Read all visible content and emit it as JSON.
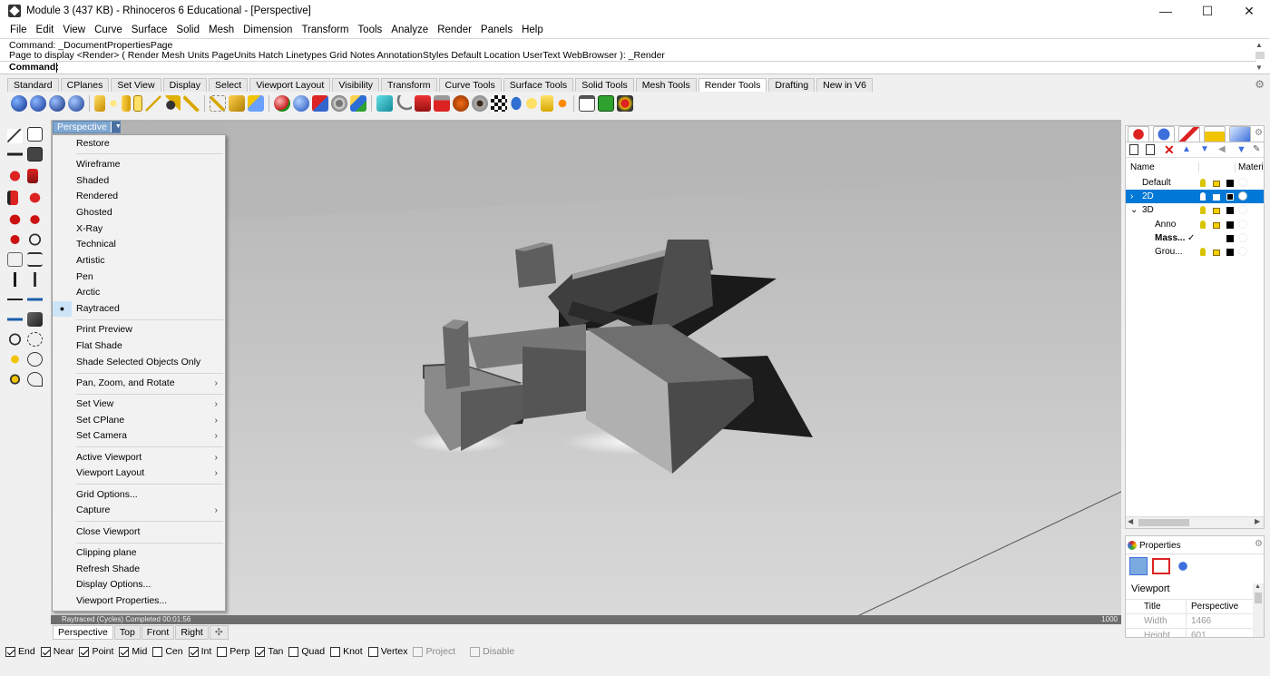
{
  "window": {
    "title": "Module 3 (437 KB) - Rhinoceros 6 Educational - [Perspective]",
    "controls": {
      "minimize": "—",
      "maximize": "☐",
      "close": "✕"
    }
  },
  "menu": [
    "File",
    "Edit",
    "View",
    "Curve",
    "Surface",
    "Solid",
    "Mesh",
    "Dimension",
    "Transform",
    "Tools",
    "Analyze",
    "Render",
    "Panels",
    "Help"
  ],
  "command": {
    "history": [
      "Command: _DocumentPropertiesPage",
      "Page to display <Render> ( Render  Mesh  Units  PageUnits  Hatch  Linetypes  Grid  Notes  AnnotationStyles  Default  Location  UserText  WebBrowser ): _Render"
    ],
    "prompt": "Command:"
  },
  "toolbar_tabs": [
    "Standard",
    "CPlanes",
    "Set View",
    "Display",
    "Select",
    "Viewport Layout",
    "Visibility",
    "Transform",
    "Curve Tools",
    "Surface Tools",
    "Solid Tools",
    "Mesh Tools",
    "Render Tools",
    "Drafting",
    "New in V6"
  ],
  "active_toolbar_tab": "Render Tools",
  "viewport": {
    "label": "Perspective",
    "status": "Raytraced (Cycles)   Completed   00:01:56",
    "resolution": "1000"
  },
  "viewport_tabs": [
    "Perspective",
    "Top",
    "Front",
    "Right"
  ],
  "context_menu": {
    "items": [
      {
        "label": "Restore"
      },
      {
        "label": "Wireframe"
      },
      {
        "label": "Shaded"
      },
      {
        "label": "Rendered"
      },
      {
        "label": "Ghosted"
      },
      {
        "label": "X-Ray"
      },
      {
        "label": "Technical"
      },
      {
        "label": "Artistic"
      },
      {
        "label": "Pen"
      },
      {
        "label": "Arctic"
      },
      {
        "label": "Raytraced",
        "checked": true
      },
      {
        "label": "Print Preview"
      },
      {
        "label": "Flat Shade"
      },
      {
        "label": "Shade Selected Objects Only"
      },
      {
        "label": "Pan, Zoom, and Rotate",
        "submenu": true
      },
      {
        "label": "Set View",
        "submenu": true
      },
      {
        "label": "Set CPlane",
        "submenu": true
      },
      {
        "label": "Set Camera",
        "submenu": true
      },
      {
        "label": "Active Viewport",
        "submenu": true
      },
      {
        "label": "Viewport Layout",
        "submenu": true
      },
      {
        "label": "Grid Options..."
      },
      {
        "label": "Capture",
        "submenu": true
      },
      {
        "label": "Close Viewport"
      },
      {
        "label": "Clipping plane"
      },
      {
        "label": "Refresh Shade"
      },
      {
        "label": "Display Options..."
      },
      {
        "label": "Viewport Properties..."
      }
    ]
  },
  "layers_panel": {
    "columns": {
      "name": "Name",
      "material": "Materi"
    },
    "layers": [
      {
        "name": "Default",
        "indent": 0
      },
      {
        "name": "2D",
        "indent": 0,
        "selected": true,
        "expander": "›"
      },
      {
        "name": "3D",
        "indent": 0,
        "expander": "⌄"
      },
      {
        "name": "Anno",
        "indent": 1
      },
      {
        "name": "Mass...",
        "indent": 1,
        "current": true,
        "mark": "✓"
      },
      {
        "name": "Grou...",
        "indent": 1
      }
    ]
  },
  "properties_panel": {
    "tab": "Properties",
    "section": "Viewport",
    "rows": [
      {
        "label": "Title",
        "value": "Perspective"
      },
      {
        "label": "Width",
        "value": "1466"
      },
      {
        "label": "Height",
        "value": "601"
      }
    ]
  },
  "osnaps": [
    {
      "label": "End",
      "checked": true
    },
    {
      "label": "Near",
      "checked": true
    },
    {
      "label": "Point",
      "checked": true
    },
    {
      "label": "Mid",
      "checked": true
    },
    {
      "label": "Cen",
      "checked": false
    },
    {
      "label": "Int",
      "checked": true
    },
    {
      "label": "Perp",
      "checked": false
    },
    {
      "label": "Tan",
      "checked": true
    },
    {
      "label": "Quad",
      "checked": false
    },
    {
      "label": "Knot",
      "checked": false
    },
    {
      "label": "Vertex",
      "checked": false
    },
    {
      "label": "Project",
      "checked": false,
      "disabled": true
    },
    {
      "label": "Disable",
      "checked": false,
      "disabled": true
    }
  ],
  "colors": {
    "accent": "#0078d7",
    "viewport_label": "#7fa7d1"
  }
}
